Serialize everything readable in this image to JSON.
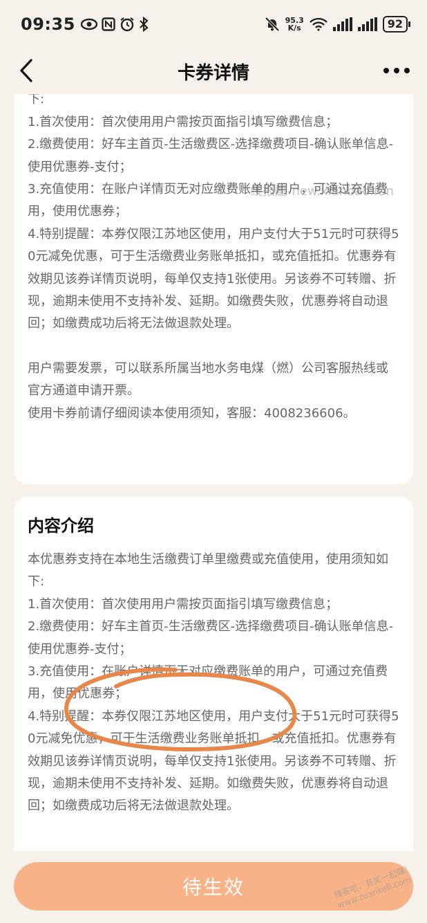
{
  "status_bar": {
    "time": "09:35",
    "net_speed_value": "95.3",
    "net_speed_unit": "K/s",
    "battery": "92"
  },
  "header": {
    "title": "卡券详情"
  },
  "card1": {
    "lines": [
      "本优惠券支持在本地生活缴费订单里缴费或充值使用，使用须知如下:",
      "1.首次使用：首次使用用户需按页面指引填写缴费信息；",
      "2.缴费使用：好车主首页-生活缴费区-选择缴费项目-确认账单信息-使用优惠券-支付；",
      "3.充值使用：在账户详情页无对应缴费账单的用户，可通过充值费用，使用优惠券；",
      "4.特别提醒：本券仅限江苏地区使用，用户支付大于51元时可获得50元减免优惠，可于生活缴费业务账单抵扣，或充值抵扣。优惠券有效期见该券详情页说明，每单仅支持1张使用。另该券不可转赠、折现，逾期未使用不支持补发、延期。如缴费失败，优惠券将自动退回；如缴费成功后将无法做退款处理。"
    ],
    "invoice_lines": [
      "用户需要发票，可以联系所属当地水务电煤（燃）公司客服热线或官方通道申请开票。",
      "使用卡券前请仔细阅读本使用须知，客服：4008236606。"
    ]
  },
  "card2": {
    "title": "内容介绍",
    "lines": [
      "本优惠券支持在本地生活缴费订单里缴费或充值使用，使用须知如下:",
      "1.首次使用：首次使用用户需按页面指引填写缴费信息；",
      "2.缴费使用：好车主首页-生活缴费区-选择缴费项目-确认账单信息-使用优惠券-支付；",
      "3.充值使用：在账户详情页无对应缴费账单的用户，可通过充值费用，使用优惠券；",
      "4.特别提醒：本券仅限江苏地区使用，用户支付大于51元时可获得50元减免优惠，可于生活缴费业务账单抵扣，或充值抵扣。优惠券有效期见该券详情页说明，每单仅支持1张使用。另该券不可转赠、折现，逾期未使用不支持补发、延期。如缴费失败，优惠券将自动退回；如缴费成功后将无法做退款处理。"
    ]
  },
  "watermark": "线报酷-new.xianbao.fun",
  "watermark2": "赚客吧，有奖一起赚！www.zuanke8.com",
  "bottom": {
    "button_label": "待生效"
  },
  "colors": {
    "background": "#f6f1ea",
    "button": "#f7b387",
    "annotation": "#e8874a"
  }
}
